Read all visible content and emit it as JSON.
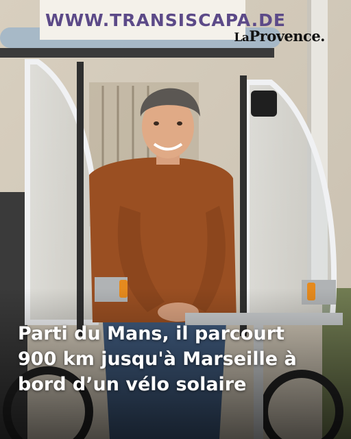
{
  "photo": {
    "banner_text": "WWW.TRANSISCAPA.DE",
    "brand_prefix": "La",
    "brand_name": "Provence.",
    "headline_lines": [
      "Parti du Mans, il parcourt",
      "900 km jusqu'à Marseille à",
      "bord d’un vélo solaire"
    ]
  },
  "colors": {
    "sweater": "#9a4f22",
    "jeans": "#3f5a7d",
    "wall": "#d9d1c3",
    "frame_white": "#eef0f2"
  }
}
